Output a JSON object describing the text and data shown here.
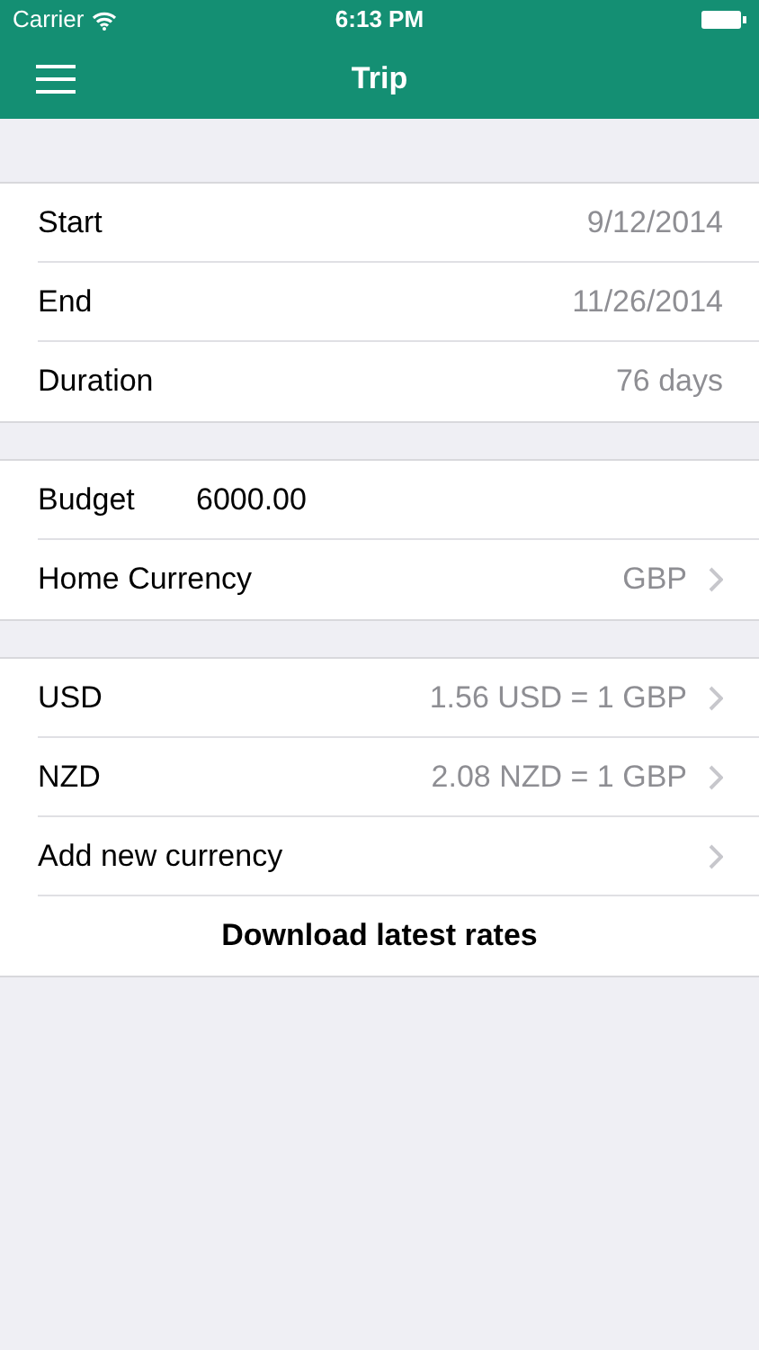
{
  "status_bar": {
    "carrier": "Carrier",
    "time": "6:13 PM"
  },
  "nav_bar": {
    "title": "Trip"
  },
  "sections": [
    {
      "rows": [
        {
          "kind": "value",
          "label": "Start",
          "value": "9/12/2014",
          "disclosure": false
        },
        {
          "kind": "value",
          "label": "End",
          "value": "11/26/2014",
          "disclosure": false
        },
        {
          "kind": "value",
          "label": "Duration",
          "value": "76 days",
          "disclosure": false
        }
      ]
    },
    {
      "rows": [
        {
          "kind": "field",
          "label": "Budget",
          "value": "6000.00"
        },
        {
          "kind": "value",
          "label": "Home Currency",
          "value": "GBP",
          "disclosure": true
        }
      ]
    },
    {
      "rows": [
        {
          "kind": "value",
          "label": "USD",
          "value": "1.56 USD = 1 GBP",
          "disclosure": true
        },
        {
          "kind": "value",
          "label": "NZD",
          "value": "2.08 NZD = 1 GBP",
          "disclosure": true
        },
        {
          "kind": "value",
          "label": "Add new currency",
          "disclosure": true
        },
        {
          "kind": "action",
          "label": "Download latest rates"
        }
      ]
    }
  ]
}
